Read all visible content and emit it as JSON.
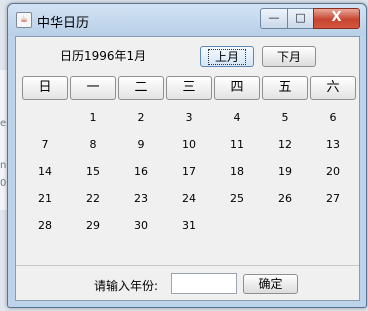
{
  "window": {
    "title": "中华日历",
    "controls": {
      "minimize": "—",
      "maximize": "□",
      "close": "X"
    }
  },
  "calendar": {
    "header": "日历1996年1月",
    "prev_label": "上月",
    "next_label": "下月",
    "weekdays": [
      "日",
      "一",
      "二",
      "三",
      "四",
      "五",
      "六"
    ],
    "days": [
      "",
      "1",
      "2",
      "3",
      "4",
      "5",
      "6",
      "7",
      "8",
      "9",
      "10",
      "11",
      "12",
      "13",
      "14",
      "15",
      "16",
      "17",
      "18",
      "19",
      "20",
      "21",
      "22",
      "23",
      "24",
      "25",
      "26",
      "27",
      "28",
      "29",
      "30",
      "31",
      "",
      "",
      ""
    ]
  },
  "footer": {
    "input_label": "请输入年份:",
    "year_value": "",
    "ok_label": "确定"
  },
  "background": {
    "fragments": [
      "en",
      "ne",
      "0"
    ]
  }
}
